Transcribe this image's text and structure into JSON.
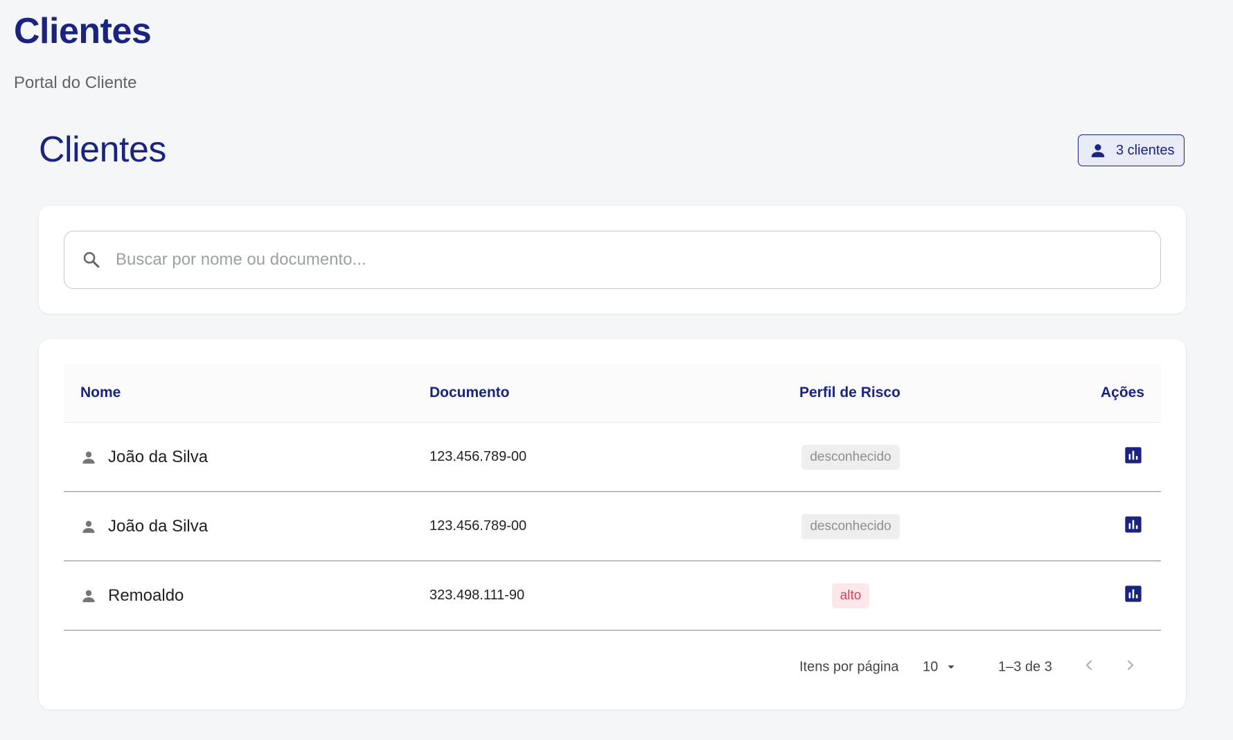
{
  "app": {
    "title": "Clientes",
    "subtitle": "Portal do Cliente"
  },
  "page": {
    "title": "Clientes",
    "count_badge": {
      "label": "3 clientes",
      "icon": "person-icon"
    }
  },
  "search": {
    "placeholder": "Buscar por nome ou documento...",
    "value": "",
    "icon": "search-icon"
  },
  "table": {
    "headers": {
      "name": "Nome",
      "document": "Documento",
      "risk": "Perfil de Risco",
      "actions": "Ações"
    },
    "rows": [
      {
        "name": "João da Silva",
        "document": "123.456.789-00",
        "risk": "desconhecido",
        "risk_level": "unknown",
        "action_icon": "bar-chart-icon"
      },
      {
        "name": "João da Silva",
        "document": "123.456.789-00",
        "risk": "desconhecido",
        "risk_level": "unknown",
        "action_icon": "bar-chart-icon"
      },
      {
        "name": "Remoaldo",
        "document": "323.498.111-90",
        "risk": "alto",
        "risk_level": "high",
        "action_icon": "bar-chart-icon"
      }
    ]
  },
  "pagination": {
    "items_per_page_label": "Itens por página",
    "page_size": "10",
    "range": "1–3 de 3"
  },
  "colors": {
    "primary": "#1a237e",
    "background": "#f5f6f7",
    "risk_unknown_bg": "#eeeeee",
    "risk_unknown_text": "#8e8e8e",
    "risk_high_bg": "#fde7ea",
    "risk_high_text": "#e53950"
  }
}
